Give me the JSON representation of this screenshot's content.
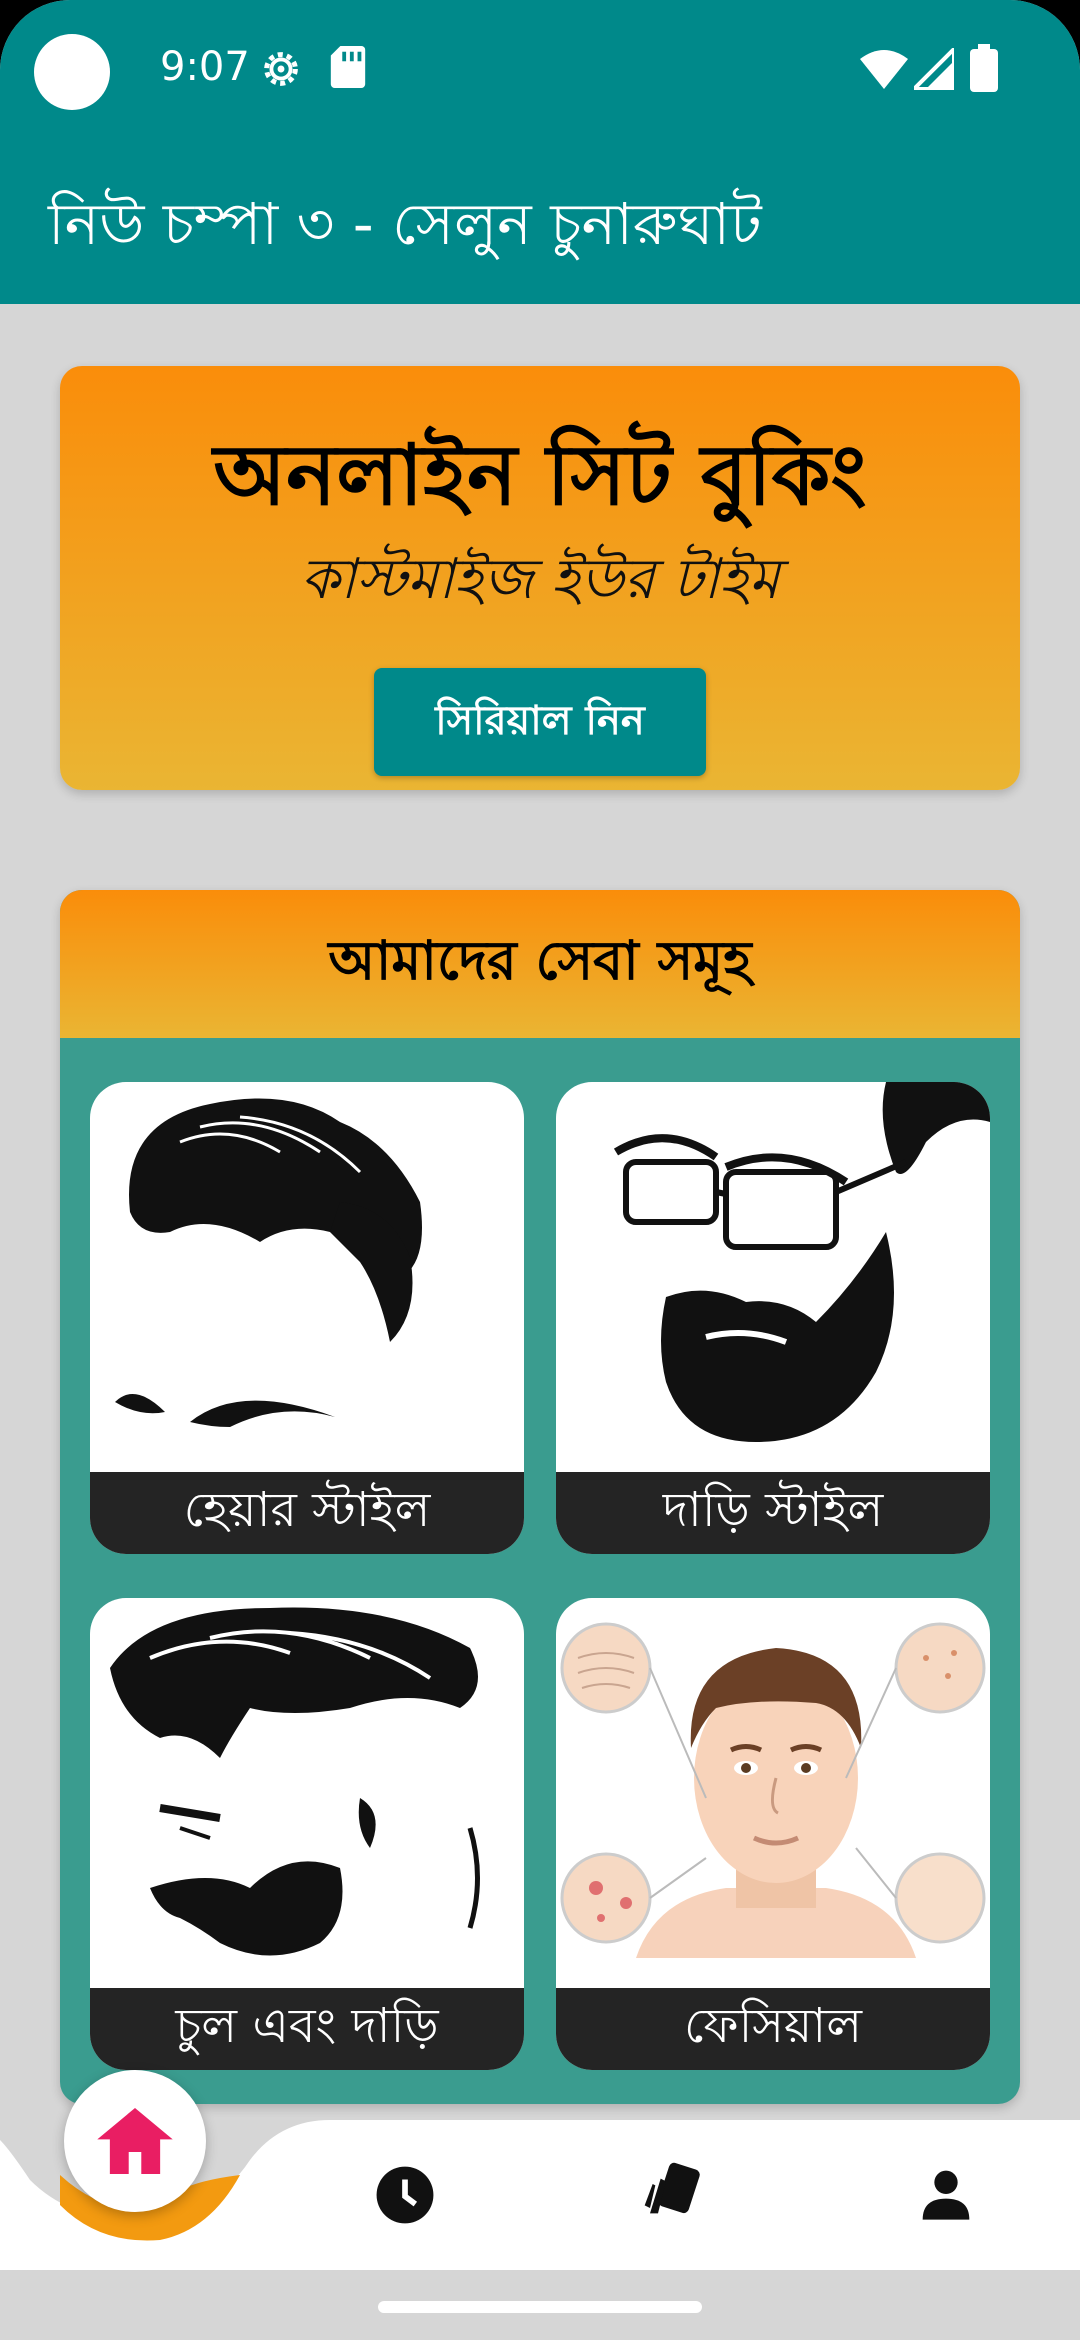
{
  "status_bar": {
    "time": "9:07",
    "icons": [
      "gear-icon",
      "sd-card-icon",
      "wifi-icon",
      "signal-icon",
      "battery-icon"
    ]
  },
  "app_bar": {
    "title": "নিউ চম্পা ৩ - সেলুন চুনারুঘাট",
    "color": "#00898a"
  },
  "booking": {
    "title": "অনলাইন সিট বুকিং",
    "subtitle": "কাস্টমাইজ ইউর টাইম",
    "button_label": "সিরিয়াল নিন",
    "gradient": [
      "#fa8d0a",
      "#eab533"
    ]
  },
  "services": {
    "title": "আমাদের সেবা সমূহ",
    "items": [
      {
        "label": "হেয়ার স্টাইল",
        "image": "hairstyle-illustration"
      },
      {
        "label": "দাড়ি স্টাইল",
        "image": "beard-style-illustration"
      },
      {
        "label": "চুল এবং দাড়ি",
        "image": "hair-and-beard-illustration"
      },
      {
        "label": "ফেসিয়াল",
        "image": "facial-illustration"
      }
    ]
  },
  "bottom_nav": {
    "items": [
      {
        "name": "home",
        "icon": "home-icon",
        "active": true
      },
      {
        "name": "history",
        "icon": "clock-icon",
        "active": false
      },
      {
        "name": "offers",
        "icon": "cards-icon",
        "active": false
      },
      {
        "name": "profile",
        "icon": "person-icon",
        "active": false
      }
    ],
    "active_color": "#e91e63"
  }
}
